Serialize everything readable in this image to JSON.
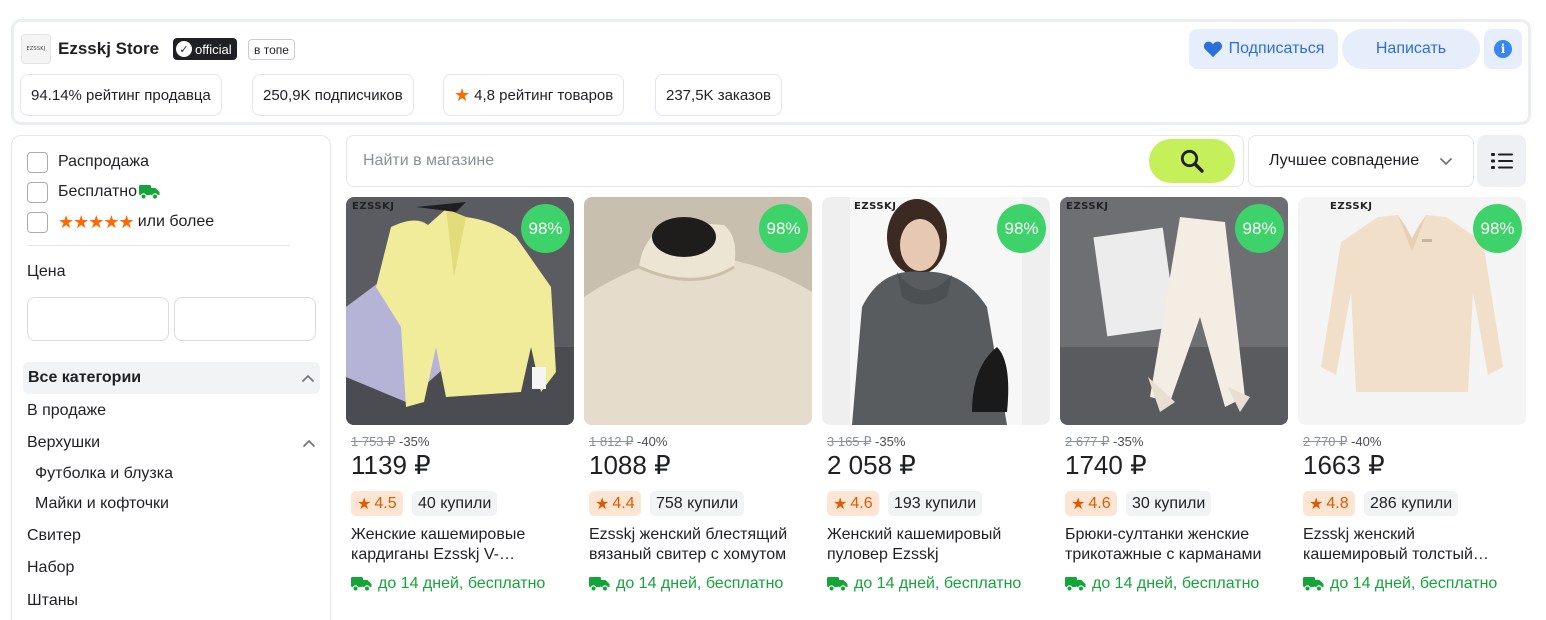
{
  "store": {
    "logo_text": "EZSSKJ",
    "name": "Ezsskj Store",
    "official_label": "official",
    "top_badge": "в топе",
    "subscribe_label": "Подписаться",
    "write_label": "Написать",
    "info_label": "i",
    "stats": [
      {
        "text": "94.14% рейтинг продавца"
      },
      {
        "text": "250,9K подписчиков"
      },
      {
        "text": "4,8 рейтинг товаров"
      },
      {
        "text": "237,5K заказов"
      }
    ]
  },
  "filters": {
    "sale_label": "Распродажа",
    "free_label": "Бесплатно",
    "stars": "★★★★★",
    "or_more_label": "или более",
    "price_label": "Цена",
    "price_from_value": "",
    "price_to_value": "",
    "categories": {
      "all_label": "Все категории",
      "on_sale_label": "В продаже",
      "tops_label": "Верхушки",
      "tshirt_label": "Футболка и блузка",
      "tank_label": "Майки и кофточки",
      "sweater_label": "Свитер",
      "set_label": "Набор",
      "pants_label": "Штаны"
    }
  },
  "search": {
    "placeholder": "Найти в магазине",
    "sort_label": "Лучшее совпадение"
  },
  "products": [
    {
      "rating_badge": "98%",
      "brand": "EZSSKJ",
      "old_price": "1 753 ₽",
      "discount": " -35%",
      "price": "1139 ₽",
      "rating": "4.5",
      "bought": "40 купили",
      "title": "Женские кашемировые кардиганы Ezsskj  V-образным вырезом",
      "delivery": "до 14 дней, бесплатно"
    },
    {
      "rating_badge": "98%",
      "brand": "",
      "old_price": "1 812 ₽",
      "discount": " -40%",
      "price": "1088 ₽",
      "rating": "4.4",
      "bought": "758 купили",
      "title": "Ezsskj женский блестящий вязаный свитер с хомутом",
      "delivery": "до 14 дней, бесплатно"
    },
    {
      "rating_badge": "98%",
      "brand": "EZSSKJ",
      "old_price": "3 165 ₽",
      "discount": " -35%",
      "price": "2 058 ₽",
      "rating": "4.6",
      "bought": "193 купили",
      "title": "Женский кашемировый пуловер Ezsskj",
      "delivery": "до 14 дней, бесплатно"
    },
    {
      "rating_badge": "98%",
      "brand": "EZSSKJ",
      "old_price": "2 677 ₽",
      "discount": " -35%",
      "price": "1740 ₽",
      "rating": "4.6",
      "bought": "30 купили",
      "title": "Брюки-султанки женские трикотажные с карманами",
      "delivery": "до 14 дней, бесплатно"
    },
    {
      "rating_badge": "98%",
      "brand": "EZSSKJ",
      "old_price": "2 770 ₽",
      "discount": " -40%",
      "price": "1663 ₽",
      "rating": "4.8",
      "bought": "286 купили",
      "title": "Ezsskj женский кашемировый толстый свитер",
      "delivery": "до 14 дней, бесплатно"
    }
  ]
}
